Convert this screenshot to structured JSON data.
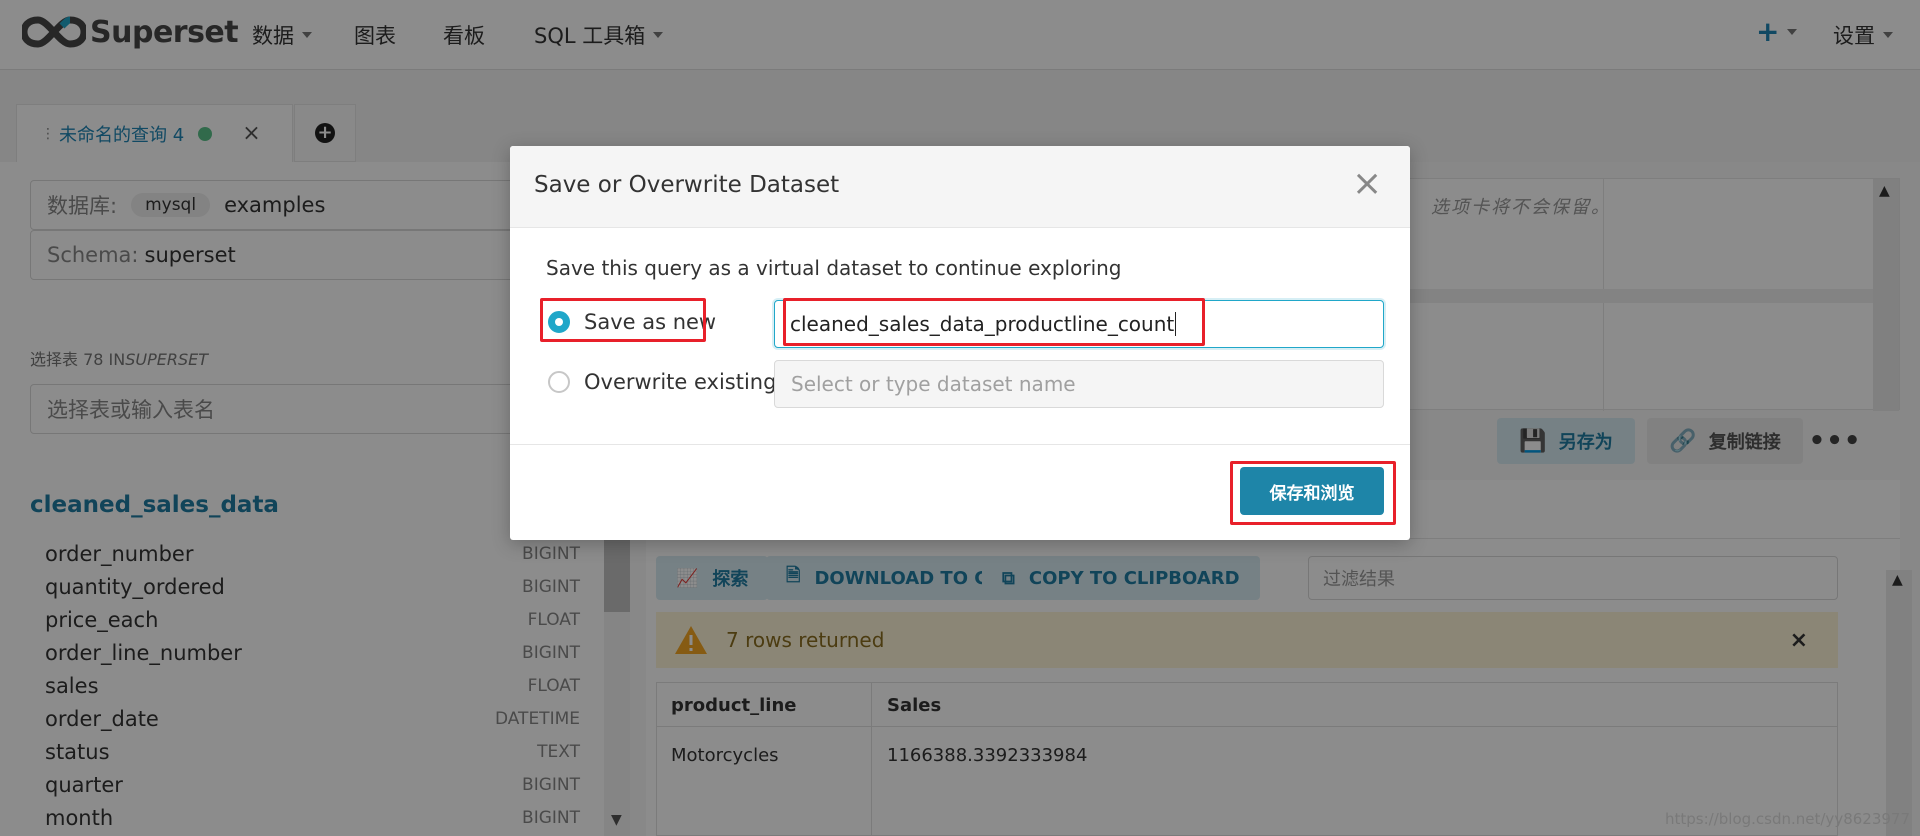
{
  "navbar": {
    "brand": "Superset",
    "items": [
      {
        "label": "数据",
        "dropdown": true
      },
      {
        "label": "图表",
        "dropdown": false
      },
      {
        "label": "看板",
        "dropdown": false
      },
      {
        "label": "SQL 工具箱",
        "dropdown": true
      }
    ],
    "plus_label": "+",
    "settings_label": "设置"
  },
  "tabs": {
    "active_title": "未命名的查询 4",
    "close_icon": "×",
    "add_icon": "+"
  },
  "left": {
    "database_label": "数据库:",
    "database_engine": "mysql",
    "database_name": "examples",
    "schema_label": "Schema:",
    "schema_value": "superset",
    "select_table_label": "选择表 78 IN",
    "select_table_schema": "SUPERSET",
    "table_search_placeholder": "选择表或输入表名",
    "table_name": "cleaned_sales_data",
    "columns": [
      {
        "name": "order_number",
        "type": "BIGINT"
      },
      {
        "name": "quantity_ordered",
        "type": "BIGINT"
      },
      {
        "name": "price_each",
        "type": "FLOAT"
      },
      {
        "name": "order_line_number",
        "type": "BIGINT"
      },
      {
        "name": "sales",
        "type": "FLOAT"
      },
      {
        "name": "order_date",
        "type": "DATETIME"
      },
      {
        "name": "status",
        "type": "TEXT"
      },
      {
        "name": "quarter",
        "type": "BIGINT"
      },
      {
        "name": "month",
        "type": "BIGINT"
      }
    ]
  },
  "editor": {
    "hint_text": "选项卡将不会保留。"
  },
  "toolbar": {
    "save_as_label": "另存为",
    "copy_link_label": "复制链接",
    "more_label": "•••"
  },
  "results": {
    "explore_label": "探索",
    "download_label": "DOWNLOAD TO CSV",
    "copy_label": "COPY TO CLIPBOARD",
    "filter_placeholder": "过滤结果",
    "rows_message": "7 rows returned",
    "headers": [
      "product_line",
      "Sales"
    ],
    "rows": [
      [
        "Motorcycles",
        "1166388.3392333984"
      ]
    ]
  },
  "modal": {
    "title": "Save or Overwrite Dataset",
    "close_icon": "×",
    "description": "Save this query as a virtual dataset to continue exploring",
    "option_new_label": "Save as new",
    "option_new_selected": true,
    "option_overwrite_label": "Overwrite existing",
    "dataset_name_value": "cleaned_sales_data_productline_count",
    "overwrite_placeholder": "Select or type dataset name",
    "save_button_label": "保存和浏览"
  },
  "watermark": "https://blog.csdn.net/yy8623977",
  "colors": {
    "brand": "#1f85b5",
    "primary_button": "#1e85a8",
    "radio_checked": "#20a7c9",
    "highlight": "#e8202a",
    "warning_bg": "#fdf5d8",
    "status_dot": "#5ac189"
  }
}
